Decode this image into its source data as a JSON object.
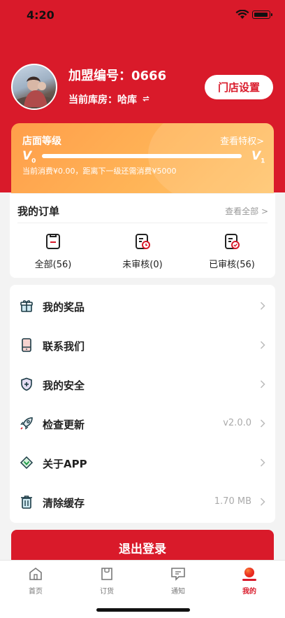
{
  "status_bar": {
    "time": "4:20"
  },
  "profile": {
    "franchise_label": "加盟编号：0666",
    "warehouse_label": "当前库房：哈库",
    "store_settings_label": "门店设置"
  },
  "level": {
    "title": "店面等级",
    "privileges_link": "查看特权>",
    "current_level": "V",
    "current_sub": "0",
    "next_level": "V",
    "next_sub": "1",
    "progress_fraction": 0.0,
    "note": "当前消费¥0.00，距离下一级还需消费¥5000"
  },
  "orders": {
    "title": "我的订单",
    "view_all": "查看全部 >",
    "items": [
      {
        "label": "全部(56)",
        "icon": "order-all-icon"
      },
      {
        "label": "未审核(0)",
        "icon": "order-pending-icon"
      },
      {
        "label": "已审核(56)",
        "icon": "order-approved-icon"
      }
    ]
  },
  "menu": {
    "items": [
      {
        "label": "我的奖品",
        "value": "",
        "icon": "gift-icon"
      },
      {
        "label": "联系我们",
        "value": "",
        "icon": "phone-icon"
      },
      {
        "label": "我的安全",
        "value": "",
        "icon": "shield-icon"
      },
      {
        "label": "检查更新",
        "value": "v2.0.0",
        "icon": "rocket-icon"
      },
      {
        "label": "关于APP",
        "value": "",
        "icon": "app-logo-icon"
      },
      {
        "label": "清除缓存",
        "value": "1.70 MB",
        "icon": "trash-icon"
      }
    ]
  },
  "logout_label": "退出登录",
  "tabbar": {
    "items": [
      {
        "label": "首页",
        "active": false
      },
      {
        "label": "订货",
        "active": false
      },
      {
        "label": "通知",
        "active": false
      },
      {
        "label": "我的",
        "active": true
      }
    ]
  },
  "colors": {
    "brand_red": "#d91a2a",
    "level_orange": "#ffb457"
  }
}
